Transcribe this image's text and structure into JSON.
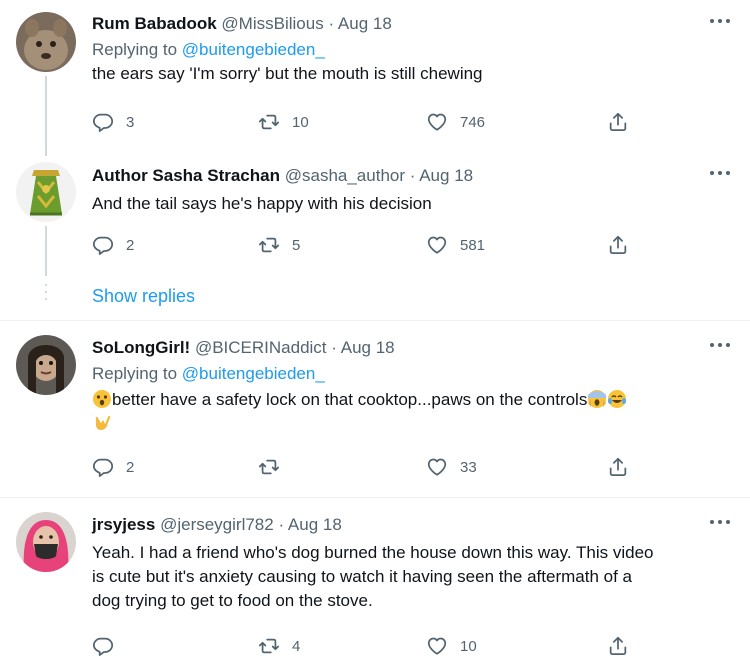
{
  "tweets": [
    {
      "name": "Rum Babadook",
      "handle": "@MissBilious",
      "sep": "·",
      "time": "Aug 18",
      "reply_prefix": "Replying to",
      "reply_mention": "@buitengebieden_",
      "text": "the ears say 'I'm sorry' but the mouth is still chewing",
      "replies": "3",
      "retweets": "10",
      "likes": "746"
    },
    {
      "name": "Author Sasha Strachan",
      "handle": "@sasha_author",
      "sep": "·",
      "time": "Aug 18",
      "text": "And the tail says he's happy with his decision",
      "replies": "2",
      "retweets": "5",
      "likes": "581"
    },
    {
      "name": "SoLongGirl!",
      "handle": "@BICERINaddict",
      "sep": "·",
      "time": "Aug 18",
      "reply_prefix": "Replying to",
      "reply_mention": "@buitengebieden_",
      "text": "better have a safety lock on that cooktop...paws on the controls",
      "replies": "2",
      "retweets": "",
      "likes": "33"
    },
    {
      "name": "jrsyjess",
      "handle": "@jerseygirl782",
      "sep": "·",
      "time": "Aug 18",
      "text_lines": [
        "Yeah. I had a friend who's dog burned the house down this way. This video",
        "is cute but it's anxiety causing to watch it having seen the aftermath of a",
        "dog trying to get to food on the stove."
      ],
      "replies": "",
      "retweets": "4",
      "likes": "10"
    }
  ],
  "show_replies": "Show replies",
  "icons": {
    "reply": "reply-icon",
    "retweet": "retweet-icon",
    "like": "heart-icon",
    "share": "share-icon",
    "more": "more-icon"
  },
  "colors": {
    "link": "#1d9bf0",
    "secondary": "#536471",
    "text": "#0f1419",
    "thread_line": "#cfd9de"
  }
}
